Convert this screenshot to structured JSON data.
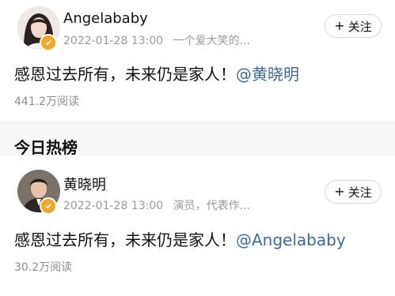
{
  "posts": [
    {
      "username": "Angelababy",
      "date": "2022-01-28 13:00",
      "bio": "一个爱大笑的...",
      "follow_label": "关注",
      "content": "感恩过去所有，未来仍是家人！",
      "mention": "@黄晓明",
      "views": "441.2万阅读",
      "avatar_icon": "portrait-woman-icon",
      "verified_icon": "verified-badge-icon"
    },
    {
      "username": "黄晓明",
      "date": "2022-01-28 13:00",
      "bio": "演员，代表作...",
      "follow_label": "关注",
      "content": "感恩过去所有，未来仍是家人！",
      "mention": "@Angelababy",
      "views": "30.2万阅读",
      "avatar_icon": "portrait-man-icon",
      "verified_icon": "verified-badge-icon"
    }
  ],
  "divider_partial_text": "今日热榜",
  "colors": {
    "mention": "#3e6aa3",
    "verified": "#f5a623",
    "meta_text": "#9a9a9a",
    "background": "#f2f2f2"
  }
}
